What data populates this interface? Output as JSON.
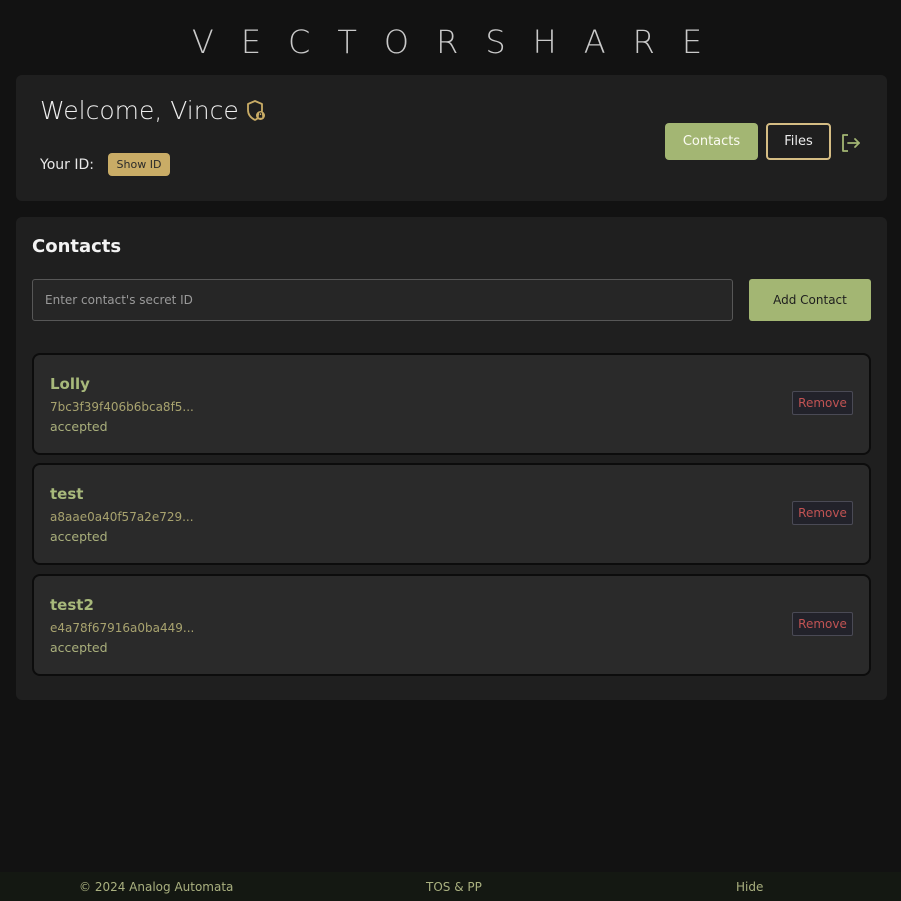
{
  "app": {
    "brand": "VECTORSHARE"
  },
  "header": {
    "welcome": "Welcome, Vince",
    "id_label": "Your ID:",
    "show_id_label": "Show ID",
    "nav": {
      "contacts_label": "Contacts",
      "files_label": "Files"
    }
  },
  "contacts": {
    "title": "Contacts",
    "input_placeholder": "Enter contact's secret ID",
    "add_label": "Add Contact",
    "remove_label": "Remove",
    "items": [
      {
        "name": "Lolly",
        "id": "7bc3f39f406b6bca8f5...",
        "status": "accepted"
      },
      {
        "name": "test",
        "id": "a8aae0a40f57a2e729...",
        "status": "accepted"
      },
      {
        "name": "test2",
        "id": "e4a78f67916a0ba449...",
        "status": "accepted"
      }
    ]
  },
  "footer": {
    "copyright": "© 2024 Analog Automata",
    "tos": "TOS & PP",
    "hide": "Hide"
  },
  "colors": {
    "accent_green": "#a3b673",
    "accent_gold": "#c9ac66",
    "danger": "#c15353"
  },
  "icons": {
    "privacy": "shield-lock-icon",
    "logout": "logout-icon"
  }
}
